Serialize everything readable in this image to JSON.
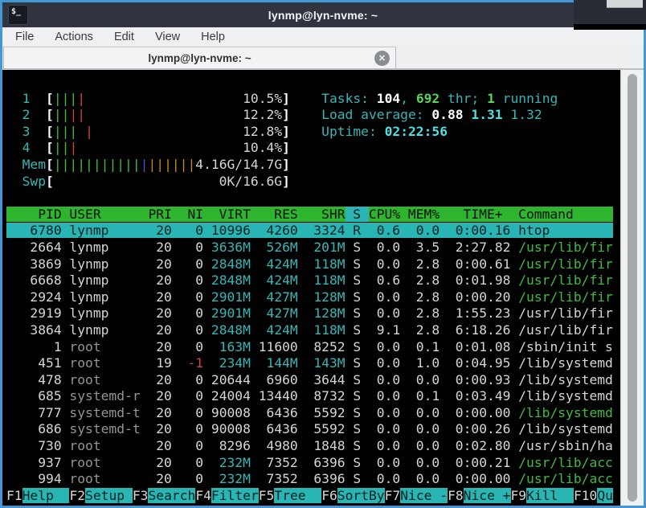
{
  "window": {
    "title": "lynmp@lyn-nvme: ~",
    "icon_glyph": "$_"
  },
  "menu": {
    "items": [
      "File",
      "Actions",
      "Edit",
      "View",
      "Help"
    ]
  },
  "tab": {
    "title": "lynmp@lyn-nvme: ~",
    "close_glyph": "✕"
  },
  "htop": {
    "meters": [
      {
        "label": "1",
        "bars": [
          [
            "gr",
            "|||"
          ],
          [
            "r",
            "|"
          ]
        ],
        "value": "10.5%"
      },
      {
        "label": "2",
        "bars": [
          [
            "gr",
            "||"
          ],
          [
            "r",
            "||"
          ]
        ],
        "value": "12.2%"
      },
      {
        "label": "3",
        "bars": [
          [
            "gr",
            "|||"
          ],
          [
            "x",
            " "
          ],
          [
            "r",
            "|"
          ]
        ],
        "value": "12.8%"
      },
      {
        "label": "4",
        "bars": [
          [
            "gr",
            "||"
          ],
          [
            "r",
            "|"
          ]
        ],
        "value": "10.4%"
      },
      {
        "label": "Mem",
        "bars": [
          [
            "gr",
            "|||||||||||"
          ],
          [
            "b",
            "|"
          ],
          [
            "o",
            "||||||"
          ]
        ],
        "value": "4.16G/14.7G"
      },
      {
        "label": "Swp",
        "bars": [],
        "value": "0K/16.6G"
      }
    ],
    "summary": [
      [
        [
          "c",
          "Tasks: "
        ],
        [
          "w",
          "104"
        ],
        [
          "c",
          ", "
        ],
        [
          "bg",
          "692"
        ],
        [
          "c",
          " thr; "
        ],
        [
          "bg",
          "1"
        ],
        [
          "c",
          " running"
        ]
      ],
      [
        [
          "c",
          "Load average: "
        ],
        [
          "w",
          "0.88 "
        ],
        [
          "bc",
          "1.31 "
        ],
        [
          "c",
          "1.32"
        ]
      ],
      [
        [
          "c",
          "Uptime: "
        ],
        [
          "bc",
          "02:22:56"
        ]
      ]
    ],
    "header_segments": [
      [
        "hdr",
        "    PID USER      PRI  NI  VIRT   RES   SHR"
      ],
      [
        "hsort",
        " S "
      ],
      [
        "hdr",
        "CPU% MEM%   TIME+  Command     "
      ]
    ],
    "columns": [
      "PID",
      "USER",
      "PRI",
      "NI",
      "VIRT",
      "RES",
      "SHR",
      "S",
      "CPU%",
      "MEM%",
      "TIME+",
      "Command"
    ],
    "sort_column": "S",
    "processes": [
      {
        "pid": "6780",
        "user": "lynmp",
        "pri": "20",
        "ni": "0",
        "virt": "10996",
        "res": "4260",
        "shr": "3324",
        "st": "R",
        "cpu": "0.6",
        "mem": "0.0",
        "time": "0:00.16",
        "cmd": "htop",
        "selected": true,
        "thread": false
      },
      {
        "pid": "2664",
        "user": "lynmp",
        "pri": "20",
        "ni": "0",
        "virt": "3636M",
        "res": "526M",
        "shr": "201M",
        "st": "S",
        "cpu": "0.0",
        "mem": "3.5",
        "time": "2:27.82",
        "cmd": "/usr/lib/fir",
        "selected": false,
        "thread": true
      },
      {
        "pid": "3869",
        "user": "lynmp",
        "pri": "20",
        "ni": "0",
        "virt": "2848M",
        "res": "424M",
        "shr": "118M",
        "st": "S",
        "cpu": "0.0",
        "mem": "2.8",
        "time": "0:00.61",
        "cmd": "/usr/lib/fir",
        "selected": false,
        "thread": true
      },
      {
        "pid": "6668",
        "user": "lynmp",
        "pri": "20",
        "ni": "0",
        "virt": "2848M",
        "res": "424M",
        "shr": "118M",
        "st": "S",
        "cpu": "0.6",
        "mem": "2.8",
        "time": "0:01.98",
        "cmd": "/usr/lib/fir",
        "selected": false,
        "thread": true
      },
      {
        "pid": "2924",
        "user": "lynmp",
        "pri": "20",
        "ni": "0",
        "virt": "2901M",
        "res": "427M",
        "shr": "128M",
        "st": "S",
        "cpu": "0.0",
        "mem": "2.8",
        "time": "0:00.20",
        "cmd": "/usr/lib/fir",
        "selected": false,
        "thread": true
      },
      {
        "pid": "2919",
        "user": "lynmp",
        "pri": "20",
        "ni": "0",
        "virt": "2901M",
        "res": "427M",
        "shr": "128M",
        "st": "S",
        "cpu": "0.0",
        "mem": "2.8",
        "time": "1:55.23",
        "cmd": "/usr/lib/fir",
        "selected": false,
        "thread": false
      },
      {
        "pid": "3864",
        "user": "lynmp",
        "pri": "20",
        "ni": "0",
        "virt": "2848M",
        "res": "424M",
        "shr": "118M",
        "st": "S",
        "cpu": "9.1",
        "mem": "2.8",
        "time": "6:18.26",
        "cmd": "/usr/lib/fir",
        "selected": false,
        "thread": false
      },
      {
        "pid": "1",
        "user": "root",
        "pri": "20",
        "ni": "0",
        "virt": "163M",
        "res": "11600",
        "shr": "8252",
        "st": "S",
        "cpu": "0.0",
        "mem": "0.1",
        "time": "0:01.08",
        "cmd": "/sbin/init s",
        "selected": false,
        "thread": false
      },
      {
        "pid": "451",
        "user": "root",
        "pri": "19",
        "ni": "-1",
        "virt": "234M",
        "res": "144M",
        "shr": "143M",
        "st": "S",
        "cpu": "0.0",
        "mem": "1.0",
        "time": "0:04.95",
        "cmd": "/lib/systemd",
        "selected": false,
        "thread": false
      },
      {
        "pid": "478",
        "user": "root",
        "pri": "20",
        "ni": "0",
        "virt": "20644",
        "res": "6960",
        "shr": "3644",
        "st": "S",
        "cpu": "0.0",
        "mem": "0.0",
        "time": "0:00.93",
        "cmd": "/lib/systemd",
        "selected": false,
        "thread": false
      },
      {
        "pid": "685",
        "user": "systemd-r",
        "pri": "20",
        "ni": "0",
        "virt": "24004",
        "res": "13440",
        "shr": "8732",
        "st": "S",
        "cpu": "0.0",
        "mem": "0.1",
        "time": "0:03.49",
        "cmd": "/lib/systemd",
        "selected": false,
        "thread": false
      },
      {
        "pid": "777",
        "user": "systemd-t",
        "pri": "20",
        "ni": "0",
        "virt": "90008",
        "res": "6436",
        "shr": "5592",
        "st": "S",
        "cpu": "0.0",
        "mem": "0.0",
        "time": "0:00.00",
        "cmd": "/lib/systemd",
        "selected": false,
        "thread": true
      },
      {
        "pid": "686",
        "user": "systemd-t",
        "pri": "20",
        "ni": "0",
        "virt": "90008",
        "res": "6436",
        "shr": "5592",
        "st": "S",
        "cpu": "0.0",
        "mem": "0.0",
        "time": "0:00.26",
        "cmd": "/lib/systemd",
        "selected": false,
        "thread": false
      },
      {
        "pid": "730",
        "user": "root",
        "pri": "20",
        "ni": "0",
        "virt": "8296",
        "res": "4980",
        "shr": "1848",
        "st": "S",
        "cpu": "0.0",
        "mem": "0.0",
        "time": "0:02.80",
        "cmd": "/usr/sbin/ha",
        "selected": false,
        "thread": false
      },
      {
        "pid": "937",
        "user": "root",
        "pri": "20",
        "ni": "0",
        "virt": "232M",
        "res": "7352",
        "shr": "6396",
        "st": "S",
        "cpu": "0.0",
        "mem": "0.0",
        "time": "0:00.21",
        "cmd": "/usr/lib/acc",
        "selected": false,
        "thread": true
      },
      {
        "pid": "994",
        "user": "root",
        "pri": "20",
        "ni": "0",
        "virt": "232M",
        "res": "7352",
        "shr": "6396",
        "st": "S",
        "cpu": "0.0",
        "mem": "0.0",
        "time": "0:00.00",
        "cmd": "/usr/lib/acc",
        "selected": false,
        "thread": true
      }
    ],
    "current_user": "lynmp",
    "fkeys": [
      [
        "F1",
        "Help  "
      ],
      [
        "F2",
        "Setup "
      ],
      [
        "F3",
        "Search"
      ],
      [
        "F4",
        "Filter"
      ],
      [
        "F5",
        "Tree  "
      ],
      [
        "F6",
        "SortBy"
      ],
      [
        "F7",
        "Nice -"
      ],
      [
        "F8",
        "Nice +"
      ],
      [
        "F9",
        "Kill  "
      ],
      [
        "F10",
        "Qu"
      ]
    ]
  },
  "colors": {
    "window_border": "#4596d6",
    "titlebar_bg": "#2f343f",
    "terminal_bg": "#010101",
    "terminal_fg": "#d3d7cf",
    "header_green": "#2eb42e",
    "selection_cyan": "#29b5b3",
    "accent_cyan": "#36b6b6",
    "bright_cyan": "#4ae2e2",
    "green": "#3fbc3f",
    "bright_green": "#56d656",
    "red": "#d04545",
    "mem_blue": "#4356d2",
    "cache_orange": "#c18a20"
  }
}
